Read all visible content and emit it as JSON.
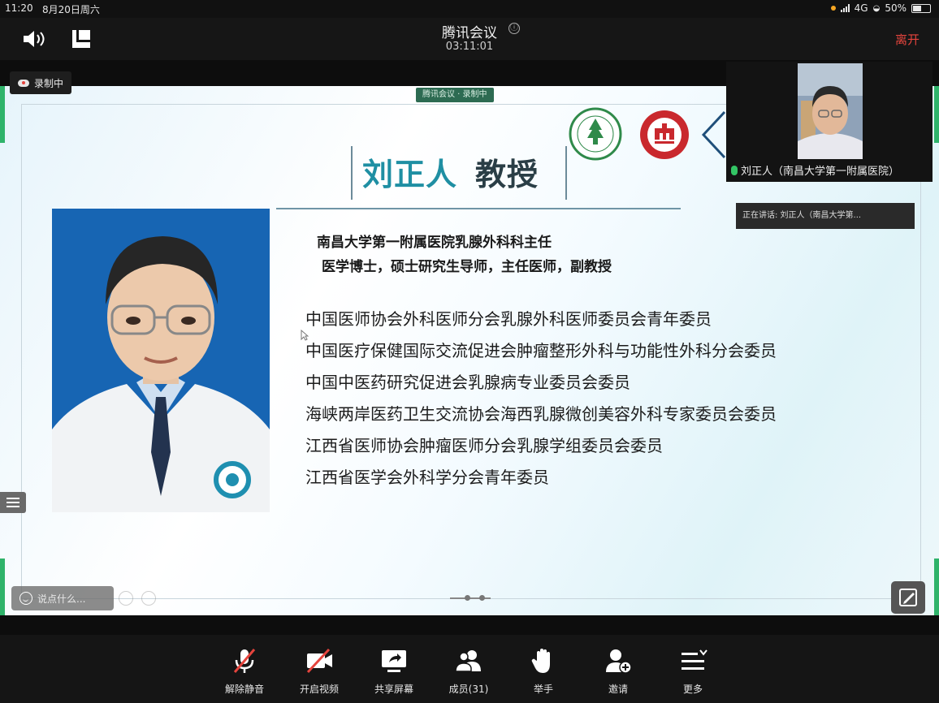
{
  "status_bar": {
    "time": "11:20",
    "date": "8月20日周六",
    "network": "4G",
    "battery": "50%",
    "battery_level": 0.5
  },
  "meeting": {
    "title": "腾讯会议",
    "timer": "03:11:01",
    "leave_label": "离开",
    "info_glyph": "ⓘ"
  },
  "recording": {
    "label": "录制中"
  },
  "slide": {
    "watermark": "腾讯会议 · 录制中",
    "name": "刘正人",
    "title": "教授",
    "department": "南昌大学第一附属医院乳腺外科科主任",
    "degree": "医学博士，硕士研究生导师，主任医师，副教授",
    "roles": [
      "中国医师协会外科医师分会乳腺外科医师委员会青年委员",
      "中国医疗保健国际交流促进会肿瘤整形外科与功能性外科分会委员",
      "中国中医药研究促进会乳腺病专业委员会委员",
      "海峡两岸医药卫生交流协会海西乳腺微创美容外科专家委员会委员",
      "江西省医师协会肿瘤医师分会乳腺学组委员会委员",
      "江西省医学会外科学分会青年委员"
    ]
  },
  "speaking_indicator": "正在讲话: 刘正人（南昌大学第...",
  "participant": {
    "label": "刘正人（南昌大学第一附属医院）",
    "mic_icon": "mic-active-icon"
  },
  "chat": {
    "placeholder": "说点什么..."
  },
  "toolbar": {
    "items": [
      {
        "label": "解除静音",
        "icon": "mic-muted-icon"
      },
      {
        "label": "开启视频",
        "icon": "video-off-icon"
      },
      {
        "label": "共享屏幕",
        "icon": "share-screen-icon"
      },
      {
        "label": "成员(31)",
        "icon": "members-icon"
      },
      {
        "label": "举手",
        "icon": "raise-hand-icon"
      },
      {
        "label": "邀请",
        "icon": "invite-icon"
      },
      {
        "label": "更多",
        "icon": "more-icon"
      }
    ]
  },
  "colors": {
    "leave": "#e5443d",
    "name_accent": "#1f8fa3",
    "photo_bg": "#1765b3",
    "edge_green": "#2fb36a"
  }
}
